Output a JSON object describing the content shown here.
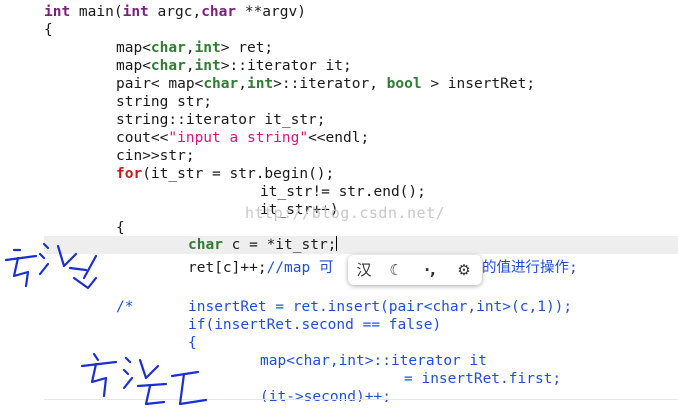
{
  "code": {
    "line1": {
      "kw1": "int",
      "rest1": " main(",
      "kw2": "int",
      "rest2": " argc,",
      "kw3": "char",
      "rest3": " **argv)"
    },
    "line2": "{",
    "line3": {
      "pre": "map<",
      "t1": "char",
      "c": ",",
      "t2": "int",
      "post": "> ret;"
    },
    "line4": {
      "pre": "map<",
      "t1": "char",
      "c": ",",
      "t2": "int",
      "post": ">::iterator it;"
    },
    "line5": {
      "pre": "pair< map<",
      "t1": "char",
      "c": ",",
      "t2": "int",
      "mid": ">::iterator, ",
      "t3": "bool",
      "post": " > insertRet;"
    },
    "line6": "string str;",
    "line7": "string::iterator it_str;",
    "line8": {
      "pre": "cout<<",
      "s": "\"input a string\"",
      "post": "<<endl;"
    },
    "line9": "cin>>str;",
    "line10": {
      "kw": "for",
      "post": "(it_str = str.begin();"
    },
    "line11": "it_str!= str.end();",
    "line12": "it_str++)",
    "line13": "{",
    "line14": {
      "t": "char",
      "post": " c = *it_str;"
    },
    "line15": {
      "pre": "ret[c]++;",
      "cm": "//map 可",
      "cm2": "的值进行操作;"
    },
    "line16": {
      "cm": "/*",
      "pre": "insertRet = ret.insert(pair<",
      "t1": "char",
      "c": ",",
      "t2": "int",
      "post": ">(c,1));"
    },
    "line17": {
      "kw": "if",
      "post": "(insertRet.second == ",
      "t": "false",
      "post2": ")"
    },
    "line18": "{",
    "line19": "map<char,int>::iterator it",
    "line20": "= insertRet.first;",
    "line21": "(it->second)++;"
  },
  "watermark": "http://blog.csdn.net/",
  "toolbar": {
    "btn1": "汉",
    "btn2": "☾",
    "btn3": "·,",
    "btn4": "⚙"
  },
  "colors": {
    "keyword": "#7a1f7a",
    "type": "#2e7d32",
    "string": "#d8177d",
    "comment": "#1f4fd8",
    "ink": "#1a2fd0"
  }
}
